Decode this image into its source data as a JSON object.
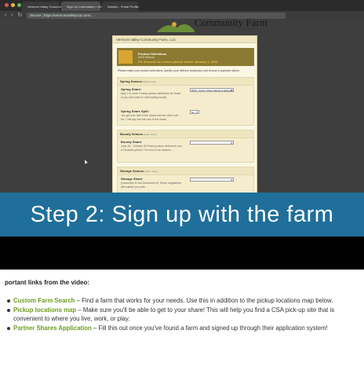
{
  "browser": {
    "tabs": [
      {
        "title": "Vermont Valley Community F..."
      },
      {
        "title": "Sign Up Information • Verm..."
      },
      {
        "title": "Weebly - Portal Profile"
      }
    ],
    "nav_glyphs": "‹ › ↻",
    "url": "Secure | https://vermontvalleycsa.com/..."
  },
  "site": {
    "logo_text": "Community Farm",
    "form_title": "Vermont Valley Community Farm, LLC",
    "banner": {
      "line1": "Product Selections",
      "line2": "2018 Season",
      "line3": "5% discount for orders placed before January 1, 2018"
    },
    "intro": "Please make your product selections, specify your delivery location(s) and choose a payment option.",
    "sections": [
      {
        "header": "Spring Season",
        "meta": "(learn more)",
        "fields": [
          {
            "label": "Spring Share:",
            "desc": "May 2 to June 9 early-season deliveries for those of you who want to start eating locally …",
            "select": "$200 - Spring Share (Weeks 8 deliveries)"
          },
          {
            "label": "Spring Share Split:",
            "desc": "You get one-half of the share and the other half ... No, I will pay the full cost of the share.",
            "select": "No"
          }
        ]
      },
      {
        "header": "Bounty Season",
        "meta": "(learn more)",
        "fields": [
          {
            "label": "Bounty Share:",
            "desc": "June 16 - October 30 Field produce delivered over a 16-week period. The end of our season ...",
            "select": ""
          }
        ]
      },
      {
        "header": "Storage Season",
        "meta": "(learn more)",
        "fields": [
          {
            "label": "Storage Share:",
            "desc": "(November 8 and December 6) These vegetables will sustain you with ...",
            "select": ""
          }
        ]
      }
    ]
  },
  "caption": "Step 2: Sign up with the farm",
  "notes": {
    "heading": "portant links from the video:",
    "items": [
      {
        "link": "Custom Farm Search",
        "text": " – Find a farm that works for your needs. Use this in addition to the pickup locations map below."
      },
      {
        "link": "Pickup locations map",
        "text": " – Make sure you'll be able to get to your share! This will help you find a CSA pick-up site that is convenient to where you live, work, or play."
      },
      {
        "link": "Partner Shares Application",
        "text": " – Fill this out once you've found a farm and signed up through their application system!"
      }
    ]
  },
  "colors": {
    "caption_band": "#1f6f9a",
    "link_green": "#6d9b1f",
    "banner_brown": "#8c7a33"
  }
}
